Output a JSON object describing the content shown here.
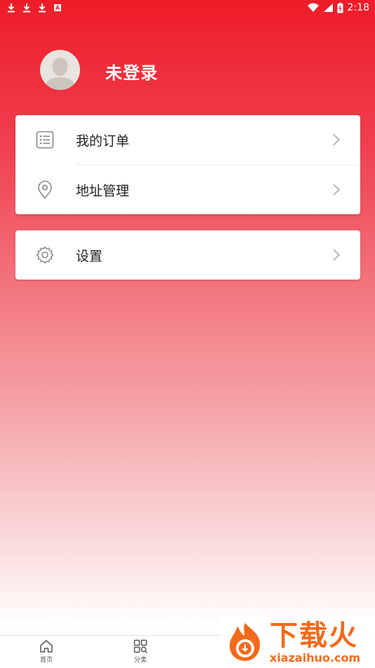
{
  "status_bar": {
    "time": "2:18"
  },
  "profile": {
    "login_text": "未登录"
  },
  "menu": {
    "items": [
      {
        "label": "我的订单",
        "icon": "order-list-icon"
      },
      {
        "label": "地址管理",
        "icon": "location-pin-icon"
      }
    ],
    "settings": {
      "label": "设置",
      "icon": "gear-icon"
    }
  },
  "tabbar": {
    "tabs": [
      {
        "label": "首页",
        "icon": "home-icon"
      },
      {
        "label": "分类",
        "icon": "category-icon"
      }
    ]
  },
  "watermark": {
    "title": "下载火",
    "url": "xiazaihuo.com"
  },
  "colors": {
    "header_red": "#ee1c28",
    "icon_gray": "#888888",
    "watermark_orange": "#f26a1b"
  }
}
